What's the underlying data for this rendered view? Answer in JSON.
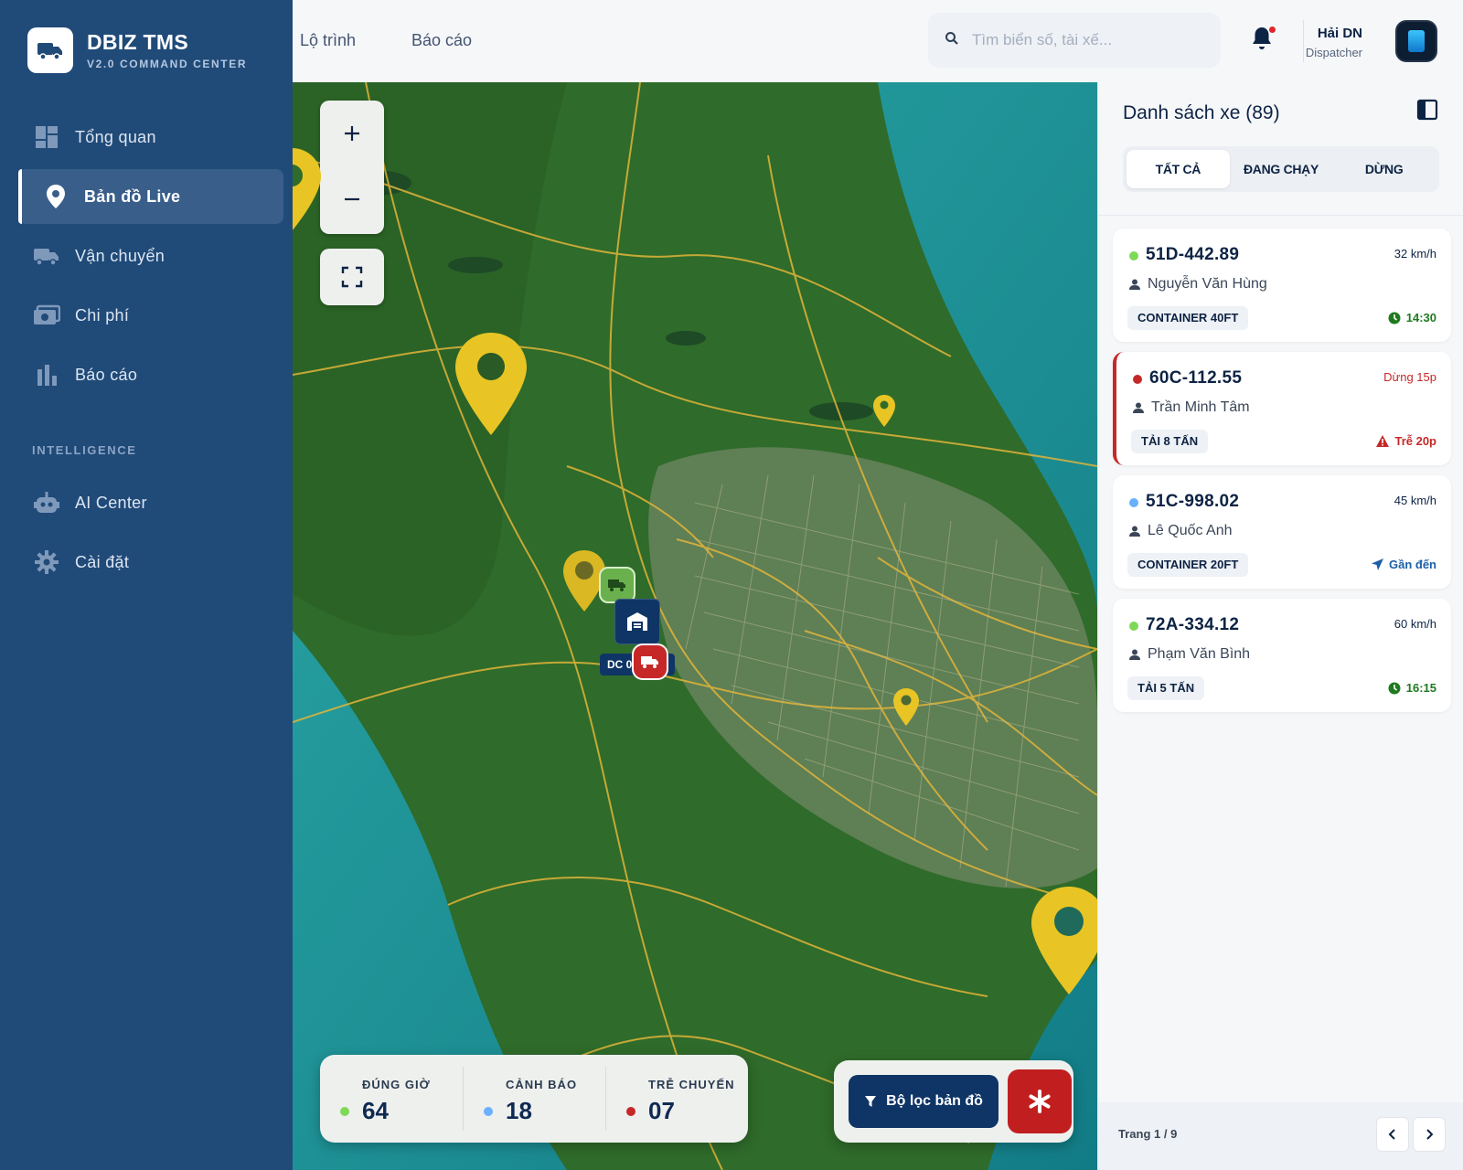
{
  "brand": {
    "title": "DBIZ TMS",
    "subtitle": "V2.0 COMMAND CENTER",
    "logo_icon": "truck-icon"
  },
  "sidebar": {
    "items": [
      {
        "label": "Tổng quan",
        "icon": "dashboard-icon",
        "active": false
      },
      {
        "label": "Bản đồ Live",
        "icon": "map-pin-icon",
        "active": true
      },
      {
        "label": "Vận chuyển",
        "icon": "truck-icon",
        "active": false
      },
      {
        "label": "Chi phí",
        "icon": "money-icon",
        "active": false
      },
      {
        "label": "Báo cáo",
        "icon": "bar-chart-icon",
        "active": false
      }
    ],
    "section_label": "INTELLIGENCE",
    "section_items": [
      {
        "label": "AI Center",
        "icon": "robot-icon"
      },
      {
        "label": "Cài đặt",
        "icon": "gear-icon"
      }
    ]
  },
  "topbar": {
    "links": [
      "Lộ trình",
      "Báo cáo"
    ],
    "search_placeholder": "Tìm biển số, tài xế...",
    "user_name": "Hải DN",
    "user_role": "Dispatcher"
  },
  "map": {
    "depot_label": "DC 01",
    "stats": [
      {
        "label": "ĐÚNG GIỜ",
        "value": "64",
        "color": "#7ed957"
      },
      {
        "label": "CẢNH BÁO",
        "value": "18",
        "color": "#6ab0ff"
      },
      {
        "label": "TRỄ CHUYẾN",
        "value": "07",
        "color": "#c62828"
      }
    ],
    "filter_label": "Bộ lọc bản đồ"
  },
  "panel": {
    "title": "Danh sách xe (89)",
    "tabs": [
      "TẤT CẢ",
      "ĐANG CHẠY",
      "DỪNG"
    ],
    "vehicles": [
      {
        "plate": "51D-442.89",
        "speed": "32 km/h",
        "driver": "Nguyễn Văn Hùng",
        "tag": "CONTAINER 40FT",
        "status": "14:30",
        "status_icon": "clock-icon",
        "dot": "#7ed957",
        "status_color": "#1f7a1f"
      },
      {
        "plate": "60C-112.55",
        "speed": "Dừng 15p",
        "driver": "Trần Minh Tâm",
        "tag": "TẢI 8 TẤN",
        "status": "Trễ 20p",
        "status_icon": "warning-icon",
        "dot": "#c62828",
        "status_color": "#c62828"
      },
      {
        "plate": "51C-998.02",
        "speed": "45 km/h",
        "driver": "Lê Quốc Anh",
        "tag": "CONTAINER 20FT",
        "status": "Gần đến",
        "status_icon": "navigation-icon",
        "dot": "#6ab0ff",
        "status_color": "#1b5fa8"
      },
      {
        "plate": "72A-334.12",
        "speed": "60 km/h",
        "driver": "Phạm Văn Bình",
        "tag": "TẢI 5 TẤN",
        "status": "16:15",
        "status_icon": "clock-icon",
        "dot": "#7ed957",
        "status_color": "#1f7a1f"
      }
    ],
    "pagination": "Trang 1 / 9"
  }
}
